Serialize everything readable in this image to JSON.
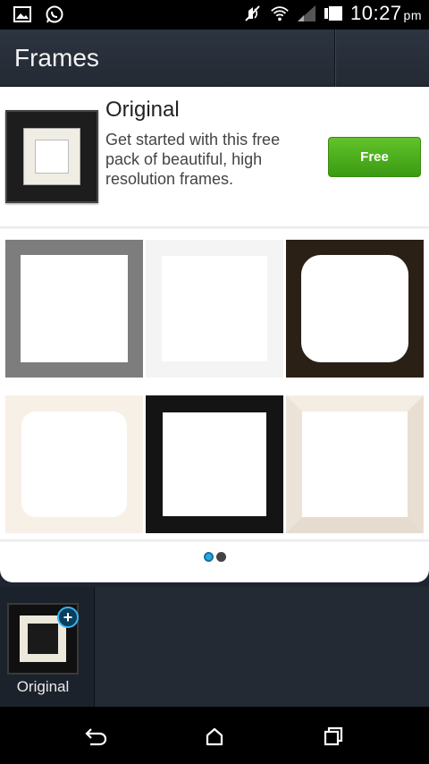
{
  "status_bar": {
    "time": "10:27",
    "ampm": "pm",
    "left_icons": [
      "image-notification-icon",
      "whatsapp-icon"
    ],
    "right_icons": [
      "mute-icon",
      "wifi-icon",
      "signal-icon",
      "battery-icon"
    ]
  },
  "action_bar": {
    "title": "Frames"
  },
  "pack": {
    "title": "Original",
    "description": "Get started with this free pack of beautiful, high resolution frames.",
    "button_label": "Free",
    "button_color": "#4cae1f"
  },
  "frames": [
    {
      "name": "gray-square-frame",
      "style": "gray"
    },
    {
      "name": "white-square-frame",
      "style": "white"
    },
    {
      "name": "dark-wood-rounded-frame",
      "style": "darkwood"
    },
    {
      "name": "cream-rounded-frame",
      "style": "cream"
    },
    {
      "name": "black-square-frame",
      "style": "black"
    },
    {
      "name": "beveled-cream-frame",
      "style": "bevel"
    }
  ],
  "pager": {
    "pages": 2,
    "current": 1,
    "active_color": "#29a8e0"
  },
  "tray": {
    "owned_pack_label": "Original",
    "add_icon": "plus-icon"
  },
  "nav_bar": {
    "buttons": [
      "back-icon",
      "home-icon",
      "recent-apps-icon"
    ]
  }
}
